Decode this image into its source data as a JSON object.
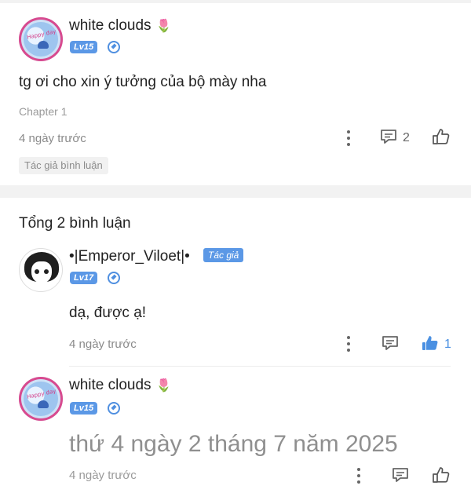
{
  "main_comment": {
    "username": "white clouds",
    "user_emoji": "🌷",
    "level": "Lv15",
    "text": "tg ơi cho xin ý tưởng của bộ mày nha",
    "chapter": "Chapter 1",
    "time": "4 ngày trước",
    "reply_count": "2",
    "author_pill": "Tác giả bình luận",
    "avatar_text": "Happy day"
  },
  "replies_header": {
    "total": "Tổng 2 bình luận"
  },
  "replies": [
    {
      "username": "•|Emperor_Viloet|•",
      "author_badge": "Tác giả",
      "level": "Lv17",
      "text": "dạ, được ạ!",
      "time": "4 ngày trước",
      "like_count": "1"
    },
    {
      "username": "white clouds",
      "user_emoji": "🌷",
      "level": "Lv15",
      "text": "thứ 4 ngày 2 tháng 7 năm 2025",
      "time": "4 ngày trước",
      "avatar_text": "Happy day"
    }
  ],
  "colors": {
    "accent_blue": "#4a90e2",
    "badge_blue": "#5b98e6",
    "separator": "#f2f2f2"
  }
}
